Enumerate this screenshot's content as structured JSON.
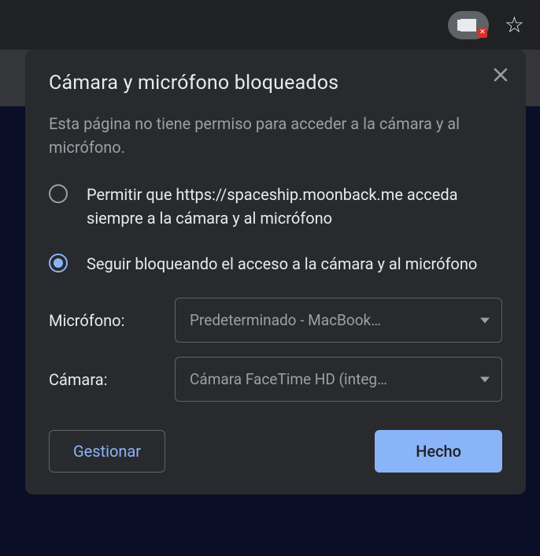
{
  "dialog": {
    "title": "Cámara y micrófono bloqueados",
    "subtitle": "Esta página no tiene permiso para acceder a la cámara y al micrófono.",
    "radioAllow": "Permitir que https://spaceship.moonback.me acceda siempre a la cámara y al micrófono",
    "radioBlock": "Seguir bloqueando el acceso a la cámara y al micrófono",
    "micLabel": "Micrófono:",
    "micValue": "Predeterminado - MacBook…",
    "camLabel": "Cámara:",
    "camValue": "Cámara FaceTime HD (integ…",
    "manageBtn": "Gestionar",
    "doneBtn": "Hecho"
  }
}
